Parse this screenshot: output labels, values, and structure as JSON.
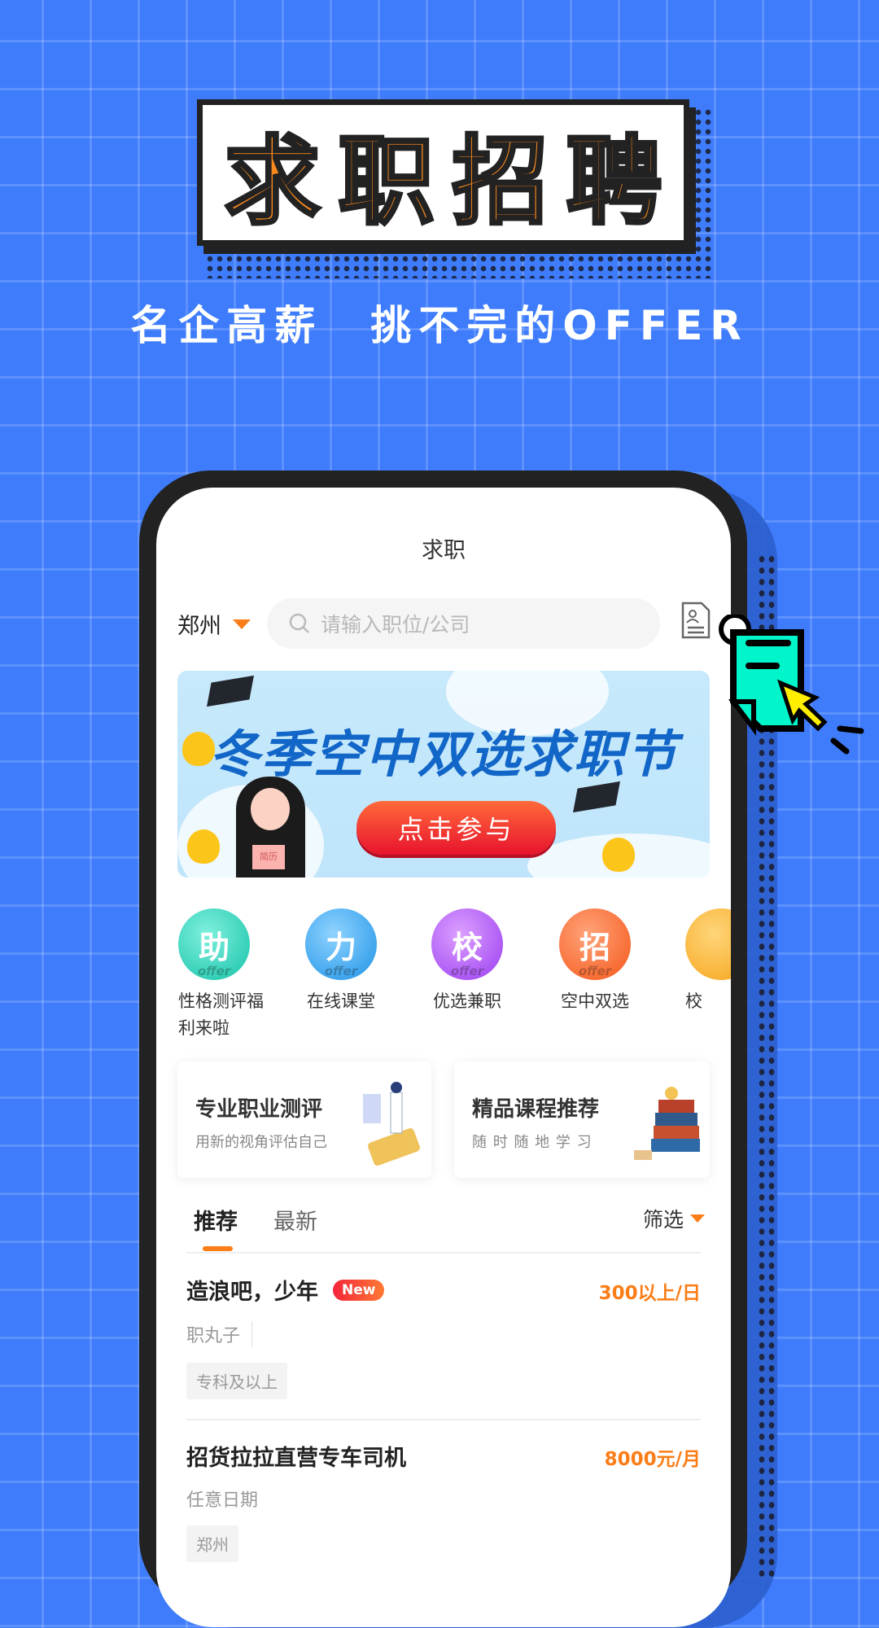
{
  "promo": {
    "title": "求职招聘",
    "subtitle": "名企高薪　挑不完的OFFER"
  },
  "app": {
    "nav_title": "求职",
    "city": "郑州",
    "search_placeholder": "请输入职位/公司",
    "banner": {
      "title": "冬季空中双选求职节",
      "button": "点击参与",
      "resume_tag": "简历"
    },
    "quick_items": [
      {
        "glyph": "助",
        "badge": "offer",
        "label": "性格测评福利来啦",
        "color": "#2ad6bd"
      },
      {
        "glyph": "力",
        "badge": "offer",
        "label": "在线课堂",
        "color": "#3aa8f0"
      },
      {
        "glyph": "校",
        "badge": "offer",
        "label": "优选兼职",
        "color": "#b056f5"
      },
      {
        "glyph": "招",
        "badge": "offer",
        "label": "空中双选",
        "color": "#fb6a2c"
      },
      {
        "glyph": "",
        "badge": "",
        "label": "校",
        "color": "#fbb12a"
      }
    ],
    "cards": [
      {
        "title": "专业职业测评",
        "subtitle": "用新的视角评估自己"
      },
      {
        "title": "精品课程推荐",
        "subtitle": "随 时 随 地 学 习"
      }
    ],
    "tabs": [
      {
        "label": "推荐",
        "active": true
      },
      {
        "label": "最新",
        "active": false
      }
    ],
    "filter_label": "筛选",
    "jobs": [
      {
        "title": "造浪吧，少年",
        "badge": "New",
        "salary": "300以上/日",
        "sub": "职丸子",
        "tag": "专科及以上"
      },
      {
        "title": "招货拉拉直营专车司机",
        "badge": "",
        "salary": "8000元/月",
        "sub": "任意日期",
        "tag": "郑州"
      }
    ],
    "accent": "#fb7d17"
  }
}
